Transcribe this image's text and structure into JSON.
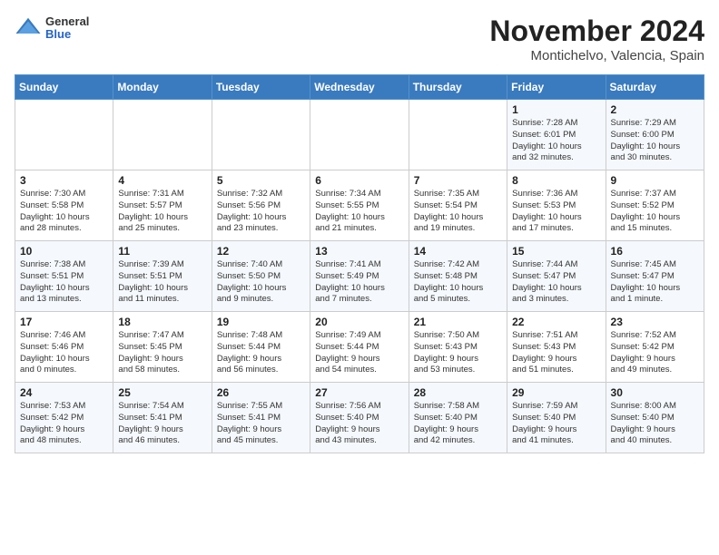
{
  "logo": {
    "general": "General",
    "blue": "Blue"
  },
  "title": "November 2024",
  "subtitle": "Montichelvo, Valencia, Spain",
  "weekdays": [
    "Sunday",
    "Monday",
    "Tuesday",
    "Wednesday",
    "Thursday",
    "Friday",
    "Saturday"
  ],
  "weeks": [
    [
      {
        "day": "",
        "info": ""
      },
      {
        "day": "",
        "info": ""
      },
      {
        "day": "",
        "info": ""
      },
      {
        "day": "",
        "info": ""
      },
      {
        "day": "",
        "info": ""
      },
      {
        "day": "1",
        "info": "Sunrise: 7:28 AM\nSunset: 6:01 PM\nDaylight: 10 hours\nand 32 minutes."
      },
      {
        "day": "2",
        "info": "Sunrise: 7:29 AM\nSunset: 6:00 PM\nDaylight: 10 hours\nand 30 minutes."
      }
    ],
    [
      {
        "day": "3",
        "info": "Sunrise: 7:30 AM\nSunset: 5:58 PM\nDaylight: 10 hours\nand 28 minutes."
      },
      {
        "day": "4",
        "info": "Sunrise: 7:31 AM\nSunset: 5:57 PM\nDaylight: 10 hours\nand 25 minutes."
      },
      {
        "day": "5",
        "info": "Sunrise: 7:32 AM\nSunset: 5:56 PM\nDaylight: 10 hours\nand 23 minutes."
      },
      {
        "day": "6",
        "info": "Sunrise: 7:34 AM\nSunset: 5:55 PM\nDaylight: 10 hours\nand 21 minutes."
      },
      {
        "day": "7",
        "info": "Sunrise: 7:35 AM\nSunset: 5:54 PM\nDaylight: 10 hours\nand 19 minutes."
      },
      {
        "day": "8",
        "info": "Sunrise: 7:36 AM\nSunset: 5:53 PM\nDaylight: 10 hours\nand 17 minutes."
      },
      {
        "day": "9",
        "info": "Sunrise: 7:37 AM\nSunset: 5:52 PM\nDaylight: 10 hours\nand 15 minutes."
      }
    ],
    [
      {
        "day": "10",
        "info": "Sunrise: 7:38 AM\nSunset: 5:51 PM\nDaylight: 10 hours\nand 13 minutes."
      },
      {
        "day": "11",
        "info": "Sunrise: 7:39 AM\nSunset: 5:51 PM\nDaylight: 10 hours\nand 11 minutes."
      },
      {
        "day": "12",
        "info": "Sunrise: 7:40 AM\nSunset: 5:50 PM\nDaylight: 10 hours\nand 9 minutes."
      },
      {
        "day": "13",
        "info": "Sunrise: 7:41 AM\nSunset: 5:49 PM\nDaylight: 10 hours\nand 7 minutes."
      },
      {
        "day": "14",
        "info": "Sunrise: 7:42 AM\nSunset: 5:48 PM\nDaylight: 10 hours\nand 5 minutes."
      },
      {
        "day": "15",
        "info": "Sunrise: 7:44 AM\nSunset: 5:47 PM\nDaylight: 10 hours\nand 3 minutes."
      },
      {
        "day": "16",
        "info": "Sunrise: 7:45 AM\nSunset: 5:47 PM\nDaylight: 10 hours\nand 1 minute."
      }
    ],
    [
      {
        "day": "17",
        "info": "Sunrise: 7:46 AM\nSunset: 5:46 PM\nDaylight: 10 hours\nand 0 minutes."
      },
      {
        "day": "18",
        "info": "Sunrise: 7:47 AM\nSunset: 5:45 PM\nDaylight: 9 hours\nand 58 minutes."
      },
      {
        "day": "19",
        "info": "Sunrise: 7:48 AM\nSunset: 5:44 PM\nDaylight: 9 hours\nand 56 minutes."
      },
      {
        "day": "20",
        "info": "Sunrise: 7:49 AM\nSunset: 5:44 PM\nDaylight: 9 hours\nand 54 minutes."
      },
      {
        "day": "21",
        "info": "Sunrise: 7:50 AM\nSunset: 5:43 PM\nDaylight: 9 hours\nand 53 minutes."
      },
      {
        "day": "22",
        "info": "Sunrise: 7:51 AM\nSunset: 5:43 PM\nDaylight: 9 hours\nand 51 minutes."
      },
      {
        "day": "23",
        "info": "Sunrise: 7:52 AM\nSunset: 5:42 PM\nDaylight: 9 hours\nand 49 minutes."
      }
    ],
    [
      {
        "day": "24",
        "info": "Sunrise: 7:53 AM\nSunset: 5:42 PM\nDaylight: 9 hours\nand 48 minutes."
      },
      {
        "day": "25",
        "info": "Sunrise: 7:54 AM\nSunset: 5:41 PM\nDaylight: 9 hours\nand 46 minutes."
      },
      {
        "day": "26",
        "info": "Sunrise: 7:55 AM\nSunset: 5:41 PM\nDaylight: 9 hours\nand 45 minutes."
      },
      {
        "day": "27",
        "info": "Sunrise: 7:56 AM\nSunset: 5:40 PM\nDaylight: 9 hours\nand 43 minutes."
      },
      {
        "day": "28",
        "info": "Sunrise: 7:58 AM\nSunset: 5:40 PM\nDaylight: 9 hours\nand 42 minutes."
      },
      {
        "day": "29",
        "info": "Sunrise: 7:59 AM\nSunset: 5:40 PM\nDaylight: 9 hours\nand 41 minutes."
      },
      {
        "day": "30",
        "info": "Sunrise: 8:00 AM\nSunset: 5:40 PM\nDaylight: 9 hours\nand 40 minutes."
      }
    ]
  ]
}
